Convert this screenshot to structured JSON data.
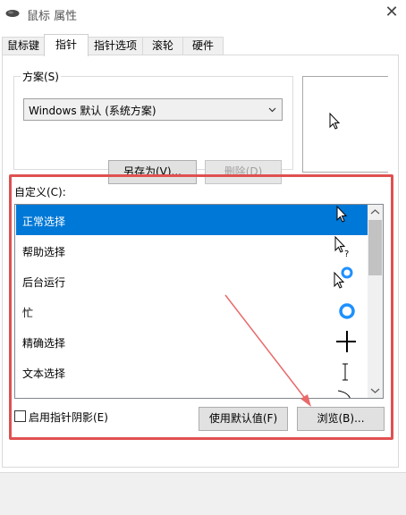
{
  "window": {
    "title": "鼠标 属性",
    "close_glyph": "✕"
  },
  "tabs": [
    {
      "label": "鼠标键",
      "active": false
    },
    {
      "label": "指针",
      "active": true
    },
    {
      "label": "指针选项",
      "active": false
    },
    {
      "label": "滚轮",
      "active": false
    },
    {
      "label": "硬件",
      "active": false
    }
  ],
  "scheme": {
    "label": "方案(S)",
    "selected": "Windows 默认 (系统方案)",
    "save_as_label": "另存为(V)...",
    "delete_label": "删除(D)",
    "delete_disabled": true
  },
  "custom": {
    "label": "自定义(C):",
    "items": [
      {
        "label": "正常选择",
        "icon": "arrow-cursor-icon",
        "selected": true
      },
      {
        "label": "帮助选择",
        "icon": "help-cursor-icon",
        "selected": false
      },
      {
        "label": "后台运行",
        "icon": "working-in-background-cursor-icon",
        "selected": false
      },
      {
        "label": "忙",
        "icon": "busy-cursor-icon",
        "selected": false
      },
      {
        "label": "精确选择",
        "icon": "crosshair-cursor-icon",
        "selected": false
      },
      {
        "label": "文本选择",
        "icon": "text-select-cursor-icon",
        "selected": false
      },
      {
        "label": "",
        "icon": "handwriting-cursor-icon",
        "selected": false
      }
    ]
  },
  "options": {
    "shadow_label": "启用指针阴影(E)",
    "shadow_checked": false,
    "use_default_label": "使用默认值(F)",
    "browse_label": "浏览(B)..."
  },
  "colors": {
    "selection": "#0078d7",
    "highlight_frame": "#e05050",
    "annotation_arrow": "#e86a6a"
  }
}
